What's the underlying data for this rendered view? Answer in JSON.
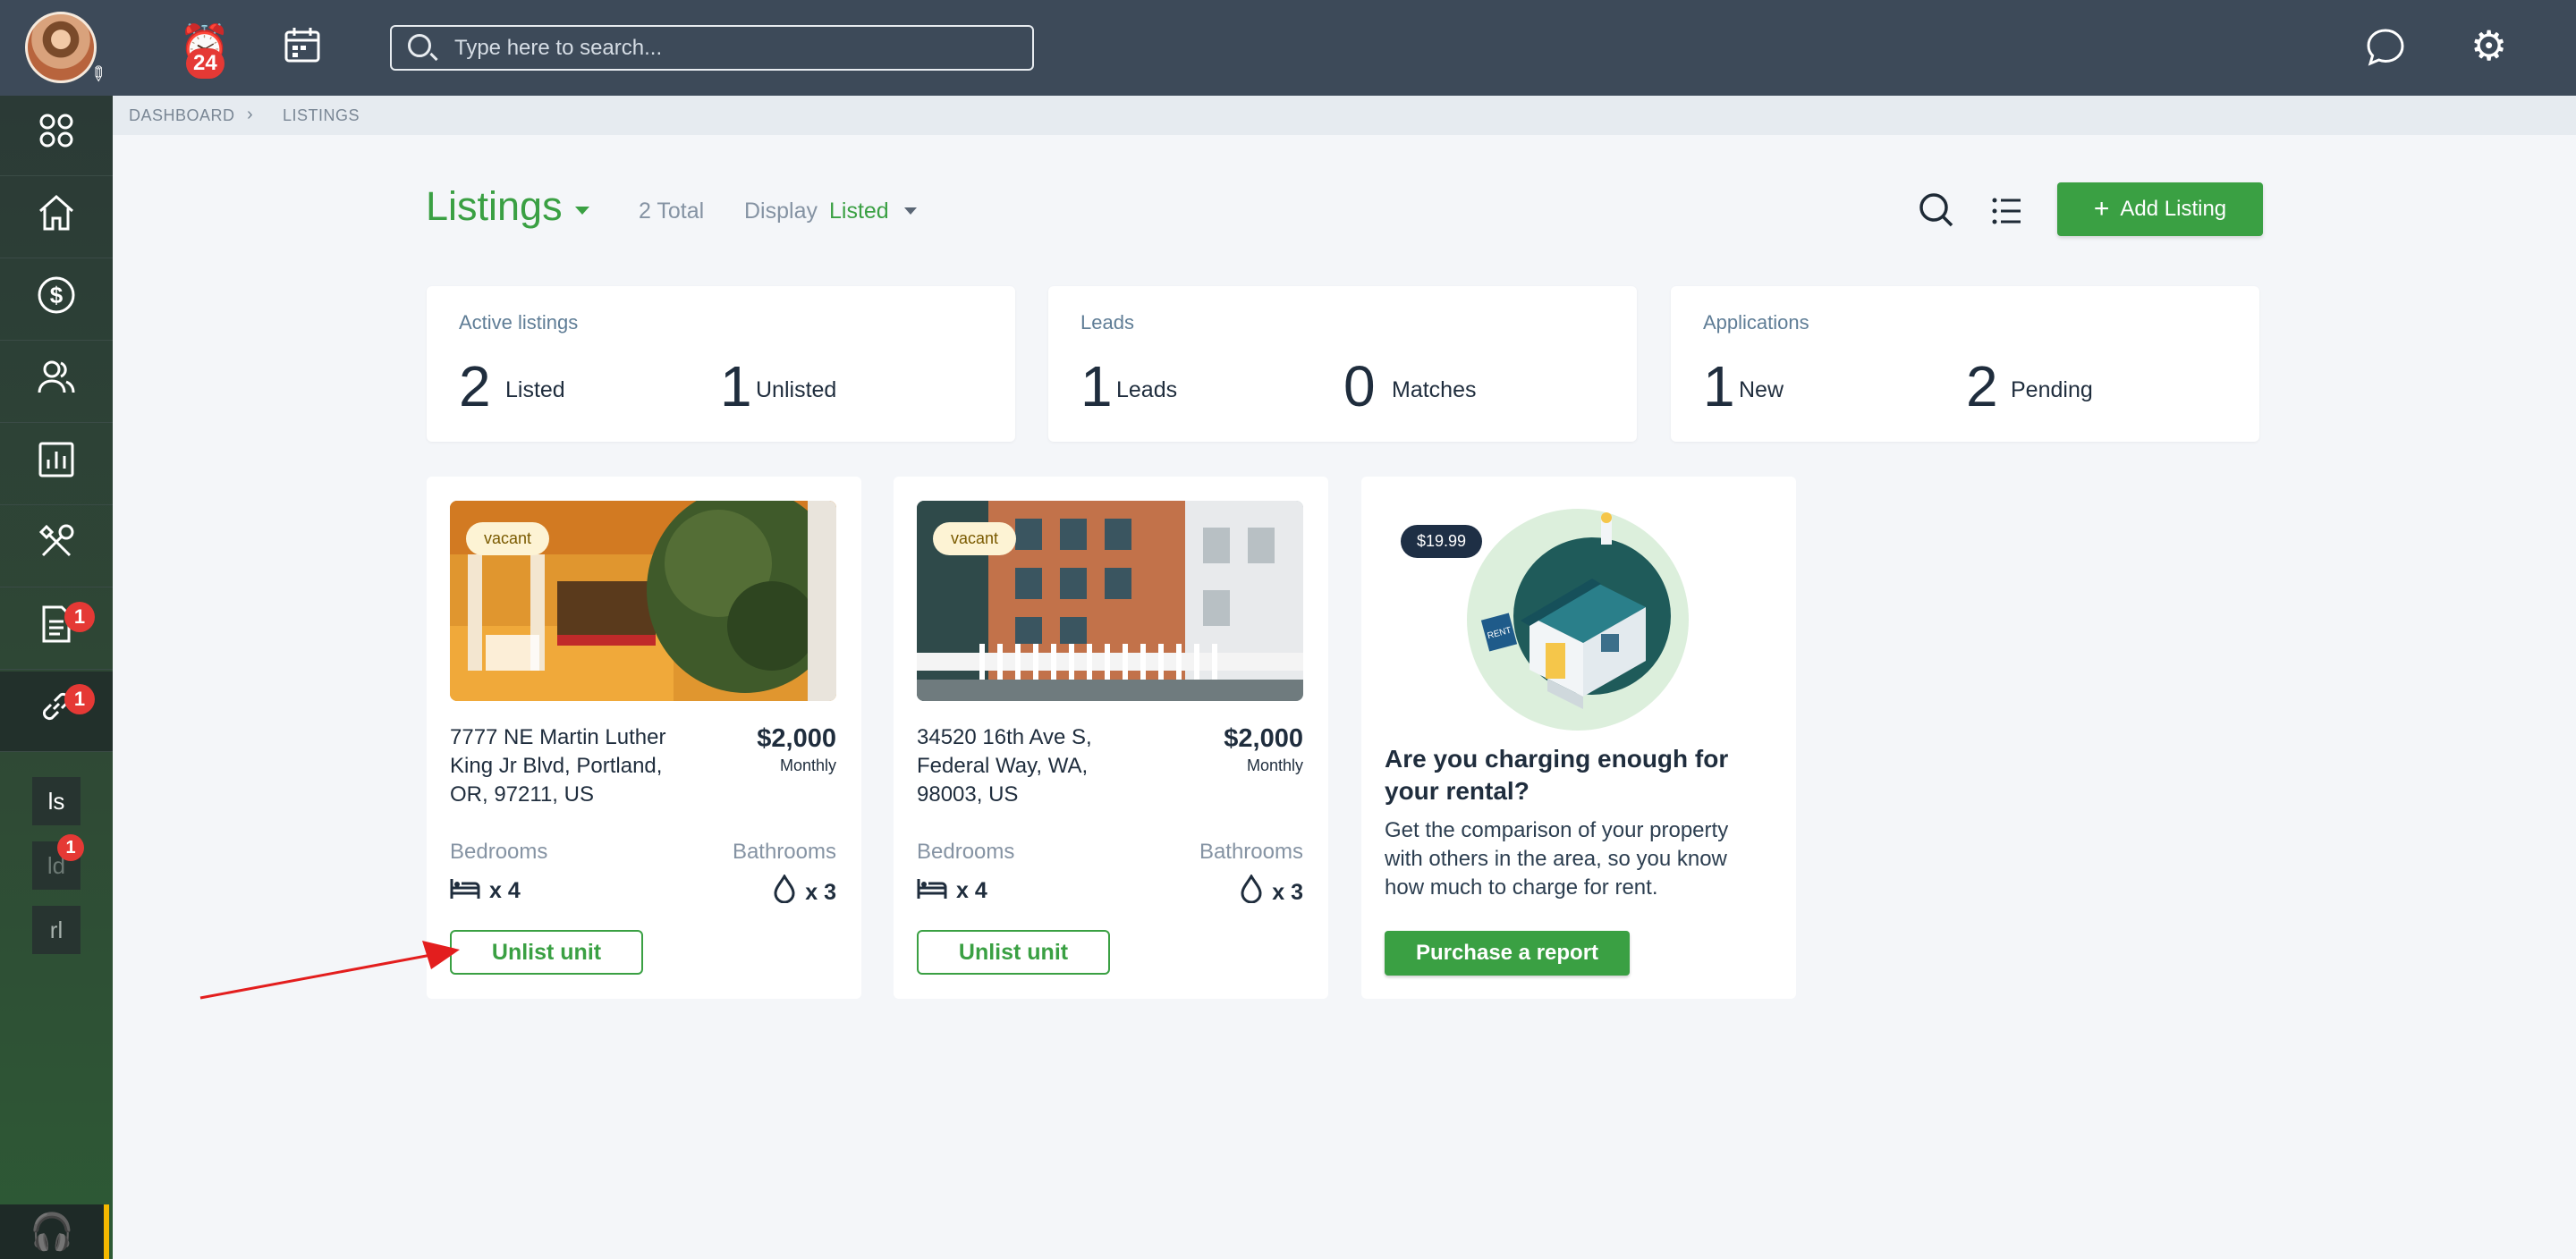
{
  "topbar": {
    "notification_count": "24",
    "search_placeholder": "Type here to search..."
  },
  "sidebar": {
    "badges": {
      "documents": "1",
      "links": "1",
      "leads_short": "1"
    },
    "short_items": [
      "ls",
      "ld",
      "rl"
    ]
  },
  "breadcrumb": {
    "items": [
      "DASHBOARD",
      "LISTINGS"
    ]
  },
  "header": {
    "title": "Listings",
    "total": "2 Total",
    "display_label": "Display",
    "display_value": "Listed",
    "add_button": "Add Listing"
  },
  "stats": [
    {
      "title": "Active listings",
      "items": [
        {
          "value": "2",
          "label": "Listed"
        },
        {
          "value": "1",
          "label": "Unlisted"
        }
      ]
    },
    {
      "title": "Leads",
      "items": [
        {
          "value": "1",
          "label": "Leads"
        },
        {
          "value": "0",
          "label": "Matches"
        }
      ]
    },
    {
      "title": "Applications",
      "items": [
        {
          "value": "1",
          "label": "New"
        },
        {
          "value": "2",
          "label": "Pending"
        }
      ]
    }
  ],
  "listings": [
    {
      "status": "vacant",
      "address": "7777 NE Martin Luther King Jr Blvd, Portland, OR, 97211, US",
      "price": "$2,000",
      "period": "Monthly",
      "bedrooms_label": "Bedrooms",
      "bathrooms_label": "Bathrooms",
      "bedrooms": "x 4",
      "bathrooms": "x 3",
      "action": "Unlist unit"
    },
    {
      "status": "vacant",
      "address": "34520 16th Ave S, Federal Way, WA, 98003, US",
      "price": "$2,000",
      "period": "Monthly",
      "bedrooms_label": "Bedrooms",
      "bathrooms_label": "Bathrooms",
      "bedrooms": "x 4",
      "bathrooms": "x 3",
      "action": "Unlist unit"
    }
  ],
  "promo": {
    "price": "$19.99",
    "title": "Are you charging enough for your rental?",
    "body": "Get the comparison of your property with others in the area, so you know how much to charge for rent.",
    "button": "Purchase a report"
  },
  "colors": {
    "accent": "#3aa043",
    "topbar": "#3d4a59",
    "badge": "#e53935"
  }
}
